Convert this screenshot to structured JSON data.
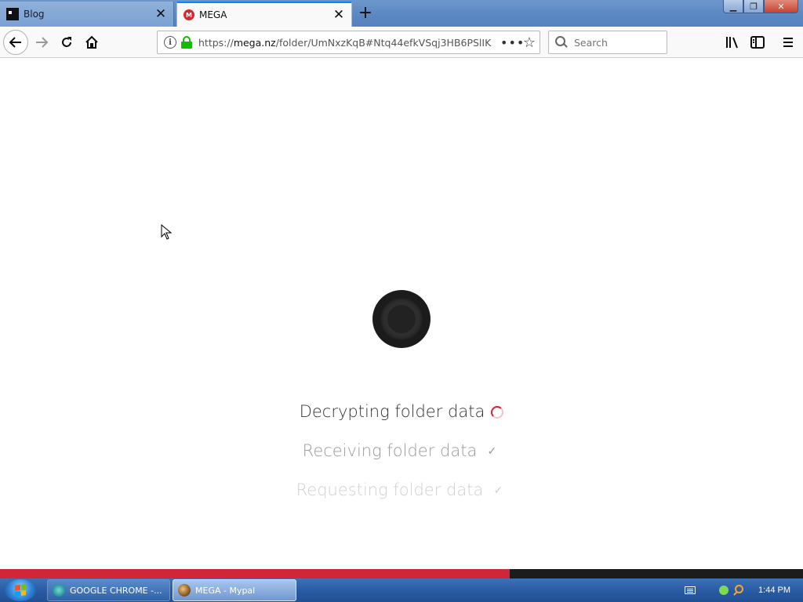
{
  "browser": {
    "tabs": [
      {
        "title": "Blog",
        "favicon": "blog-favicon"
      },
      {
        "title": "MEGA",
        "favicon": "mega-favicon"
      }
    ],
    "url": {
      "scheme": "https://",
      "host": "mega.nz",
      "path": "/folder/UmNxzKqB#Ntq44efkVSqj3HB6PSlIK"
    },
    "search_placeholder": "Search",
    "new_tab_symbol": "+"
  },
  "page": {
    "logo": "mega-logo",
    "steps": [
      {
        "label": "Decrypting folder data",
        "state": "in-progress"
      },
      {
        "label": "Receiving folder data",
        "state": "done",
        "mark": "✓"
      },
      {
        "label": "Requesting folder data",
        "state": "done",
        "mark": "✓"
      }
    ],
    "progress_percent": 63.5,
    "accent_color": "#d0263a"
  },
  "taskbar": {
    "items": [
      {
        "label": "GOOGLE CHROME -...",
        "icon": "chrome-icon"
      },
      {
        "label": "MEGA - Mypal",
        "icon": "mypal-icon",
        "active": true
      }
    ],
    "clock": "1:44 PM"
  }
}
